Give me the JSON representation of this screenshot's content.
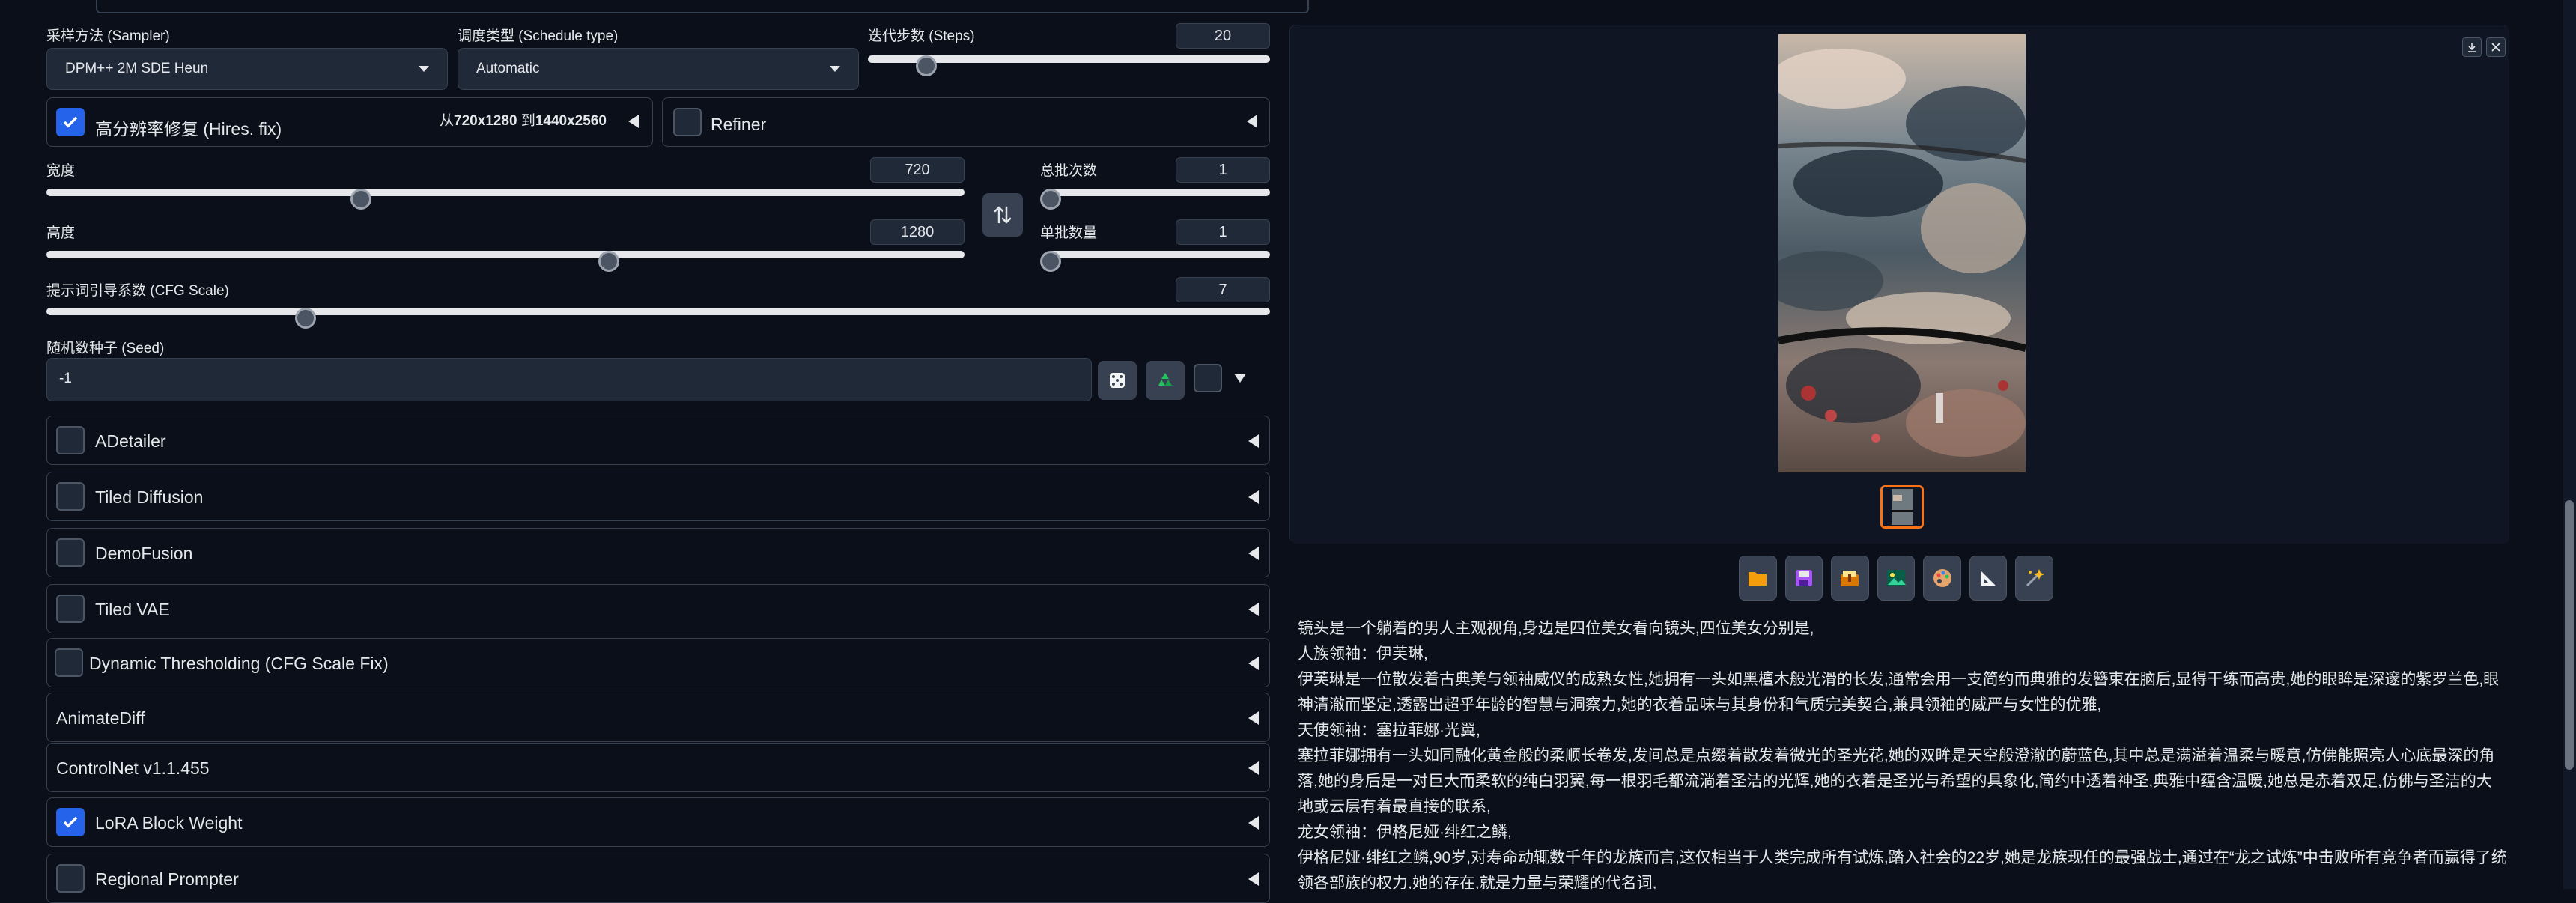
{
  "sampler": {
    "label": "采样方法 (Sampler)",
    "value": "DPM++ 2M SDE Heun"
  },
  "schedule": {
    "label": "调度类型 (Schedule type)",
    "value": "Automatic"
  },
  "steps": {
    "label": "迭代步数 (Steps)",
    "value": "20",
    "fraction": 0.14
  },
  "hires": {
    "label": "高分辨率修复 (Hires. fix)",
    "info_prefix": "从",
    "from": "720x1280",
    "to_word": " 到",
    "to": "1440x2560",
    "checked": true
  },
  "refiner": {
    "label": "Refiner",
    "checked": false
  },
  "width": {
    "label": "宽度",
    "value": "720",
    "fraction": 0.34
  },
  "height": {
    "label": "高度",
    "value": "1280",
    "fraction": 0.61
  },
  "swap_icon": "swap-icon",
  "batch_count": {
    "label": "总批次数",
    "value": "1",
    "fraction": 0.0
  },
  "batch_size": {
    "label": "单批数量",
    "value": "1",
    "fraction": 0.0
  },
  "cfg": {
    "label": "提示词引导系数 (CFG Scale)",
    "value": "7",
    "fraction": 0.21
  },
  "seed": {
    "label": "随机数种子 (Seed)",
    "value": "-1"
  },
  "accordions": [
    {
      "label": "ADetailer",
      "has_checkbox": true,
      "checked": false
    },
    {
      "label": "Tiled Diffusion",
      "has_checkbox": true,
      "checked": false
    },
    {
      "label": "DemoFusion",
      "has_checkbox": true,
      "checked": false
    },
    {
      "label": "Tiled VAE",
      "has_checkbox": true,
      "checked": false
    },
    {
      "label": "Dynamic Thresholding (CFG Scale Fix)",
      "has_checkbox": true,
      "checked": false
    },
    {
      "label": "AnimateDiff",
      "has_checkbox": false
    },
    {
      "label": "ControlNet v1.1.455",
      "has_checkbox": false
    },
    {
      "label": "LoRA Block Weight",
      "has_checkbox": true,
      "checked": true
    },
    {
      "label": "Regional Prompter",
      "has_checkbox": true,
      "checked": false
    }
  ],
  "gallery_tools": [
    "download-icon",
    "close-icon"
  ],
  "toolbar": [
    "folder-icon",
    "save-icon",
    "zip-icon",
    "image-icon",
    "palette-icon",
    "ruler-icon",
    "sparkle-icon"
  ],
  "description": [
    "镜头是一个躺着的男人主观视角,身边是四位美女看向镜头,四位美女分别是,",
    "人族领袖：伊芙琳,",
    "伊芙琳是一位散发着古典美与领袖威仪的成熟女性,她拥有一头如黑檀木般光滑的长发,通常会用一支简约而典雅的发簪束在脑后,显得干练而高贵,她的眼眸是深邃的紫罗兰色,眼",
    "神清澈而坚定,透露出超乎年龄的智慧与洞察力,她的衣着品味与其身份和气质完美契合,兼具领袖的威严与女性的优雅,",
    "天使领袖：塞拉菲娜·光翼,",
    "塞拉菲娜拥有一头如同融化黄金般的柔顺长卷发,发间总是点缀着散发着微光的圣光花,她的双眸是天空般澄澈的蔚蓝色,其中总是满溢着温柔与暖意,仿佛能照亮人心底最深的角",
    "落,她的身后是一对巨大而柔软的纯白羽翼,每一根羽毛都流淌着圣洁的光辉,她的衣着是圣光与希望的具象化,简约中透着神圣,典雅中蕴含温暖,她总是赤着双足,仿佛与圣洁的大",
    "地或云层有着最直接的联系,",
    "龙女领袖：伊格尼娅·绯红之鳞,",
    "伊格尼娅·绯红之鳞,90岁,对寿命动辄数千年的龙族而言,这仅相当于人类完成所有试炼,踏入社会的22岁,她是龙族现任的最强战士,通过在“龙之试炼”中击败所有竞争者而赢得了统",
    "领各部族的权力,她的存在,就是力量与荣耀的代名词,"
  ]
}
